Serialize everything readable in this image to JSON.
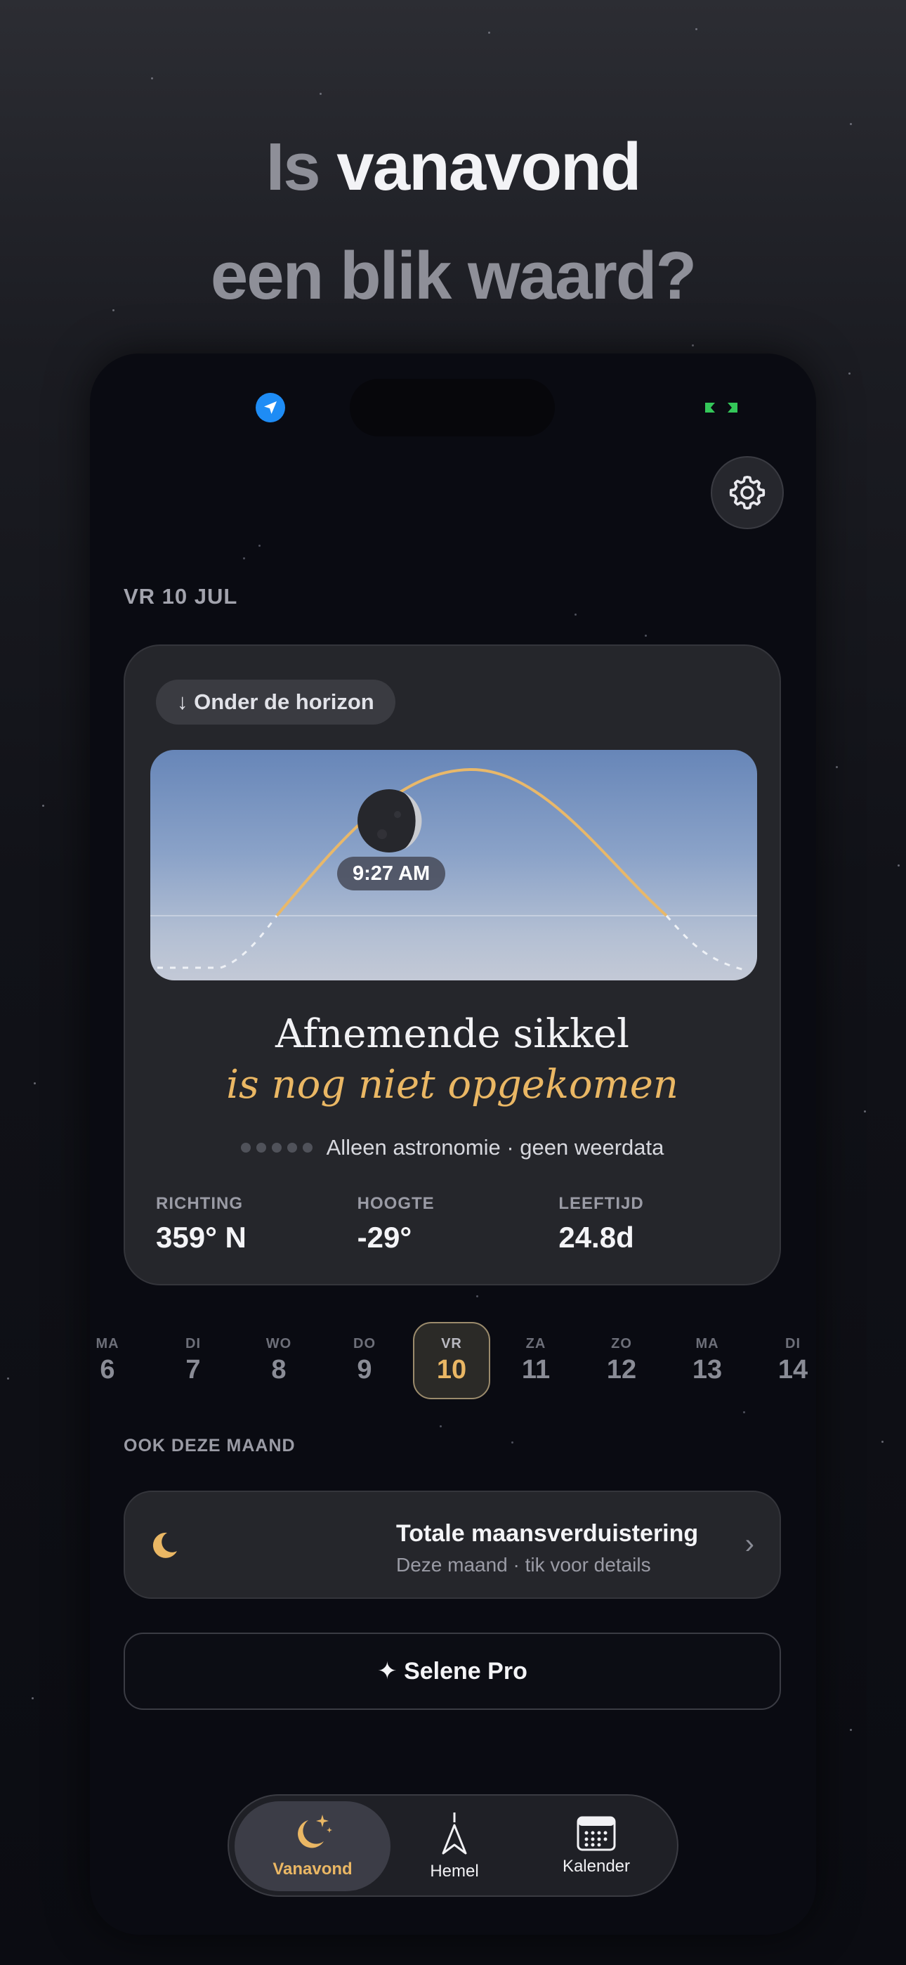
{
  "headline": {
    "part1": "Is",
    "part2": "vanavond",
    "line2": "een blik waard?"
  },
  "status": {
    "location_icon": "location-arrow-icon",
    "right_icon": "link-icon"
  },
  "date": "VR 10 JUL",
  "moon_card": {
    "horizon_status": "↓ Onder de horizon",
    "time": "9:27 AM",
    "phase_name": "Afnemende sikkel",
    "phase_status": "is nog niet opgekomen",
    "weather_note": "Alleen astronomie · geen weerdata",
    "stats": [
      {
        "label": "RICHTING",
        "value": "359° N"
      },
      {
        "label": "HOOGTE",
        "value": "-29°"
      },
      {
        "label": "LEEFTIJD",
        "value": "24.8d"
      }
    ]
  },
  "days": [
    {
      "name": "MA",
      "num": "6"
    },
    {
      "name": "DI",
      "num": "7"
    },
    {
      "name": "WO",
      "num": "8"
    },
    {
      "name": "DO",
      "num": "9"
    },
    {
      "name": "VR",
      "num": "10"
    },
    {
      "name": "ZA",
      "num": "11"
    },
    {
      "name": "ZO",
      "num": "12"
    },
    {
      "name": "MA",
      "num": "13"
    },
    {
      "name": "DI",
      "num": "14"
    }
  ],
  "selected_day_index": 4,
  "section_label": "OOK DEZE MAAND",
  "event": {
    "title": "Totale maansverduistering",
    "subtitle": "Deze maand · tik voor details",
    "chevron": "›"
  },
  "pro_button": "✦ Selene Pro",
  "tabs": [
    {
      "label": "Vanavond",
      "icon": "moon-stars-icon"
    },
    {
      "label": "Hemel",
      "icon": "compass-arrow-icon"
    },
    {
      "label": "Kalender",
      "icon": "calendar-icon"
    }
  ],
  "colors": {
    "accent": "#eab764",
    "location": "#1e8cf5",
    "status_green": "#34c759"
  }
}
